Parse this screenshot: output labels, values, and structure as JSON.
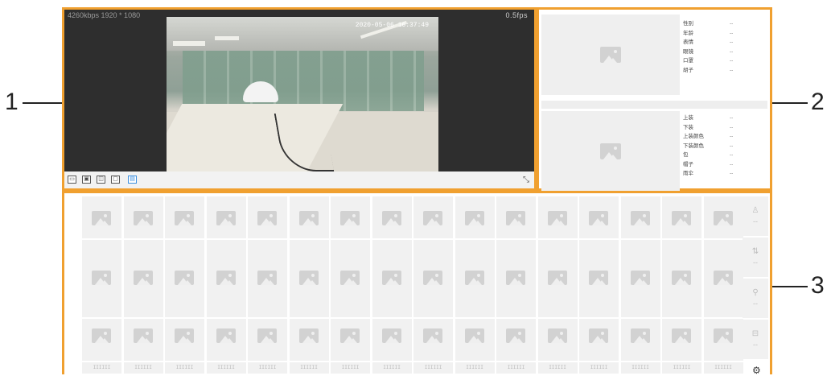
{
  "callouts": [
    "1",
    "2",
    "3"
  ],
  "video": {
    "stream_info": "4260kbps 1920 * 1080",
    "frame_rate": "0.5fps",
    "timestamp": "2020-05-06 16:37:49"
  },
  "toolbar": {
    "buttons": [
      "▭",
      "▣",
      "◫",
      "▢",
      "▤"
    ],
    "active_index": 4,
    "expand_icon": "⤡"
  },
  "attributes": {
    "face": [
      {
        "label": "性别",
        "value": "--"
      },
      {
        "label": "年龄",
        "value": "--"
      },
      {
        "label": "表情",
        "value": "--"
      },
      {
        "label": "眼镜",
        "value": "--"
      },
      {
        "label": "口罩",
        "value": "--"
      },
      {
        "label": "胡子",
        "value": "--"
      }
    ],
    "body": [
      {
        "label": "上装",
        "value": "--"
      },
      {
        "label": "下装",
        "value": "--"
      },
      {
        "label": "上装颜色",
        "value": "--"
      },
      {
        "label": "下装颜色",
        "value": "--"
      },
      {
        "label": "包",
        "value": "--"
      },
      {
        "label": "帽子",
        "value": "--"
      },
      {
        "label": "雨伞",
        "value": "--"
      }
    ]
  },
  "grid": {
    "cell_label": "IIIIII",
    "side_counts": [
      {
        "icon": "person-icon",
        "glyph": "♙",
        "count": "--"
      },
      {
        "icon": "motor-vehicle-icon",
        "glyph": "⇅",
        "count": "--"
      },
      {
        "icon": "bicycle-icon",
        "glyph": "⚲",
        "count": "--"
      },
      {
        "icon": "car-icon",
        "glyph": "⊟",
        "count": "--"
      }
    ],
    "settings_icon": "⚙"
  },
  "colors": {
    "panel_border": "#f0a030",
    "active_button": "#3b8fe0",
    "video_background": "#2e2e2e"
  }
}
